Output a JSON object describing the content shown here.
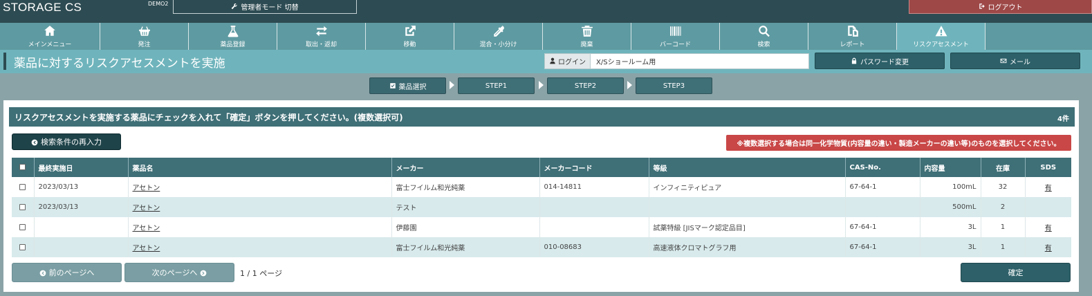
{
  "brand": "STORAGE CS",
  "demo_label": "DEMO2",
  "admin_button": "管理者モード 切替",
  "logout_button": "ログアウト",
  "nav": [
    {
      "label": "メインメニュー",
      "icon": "home-icon"
    },
    {
      "label": "発注",
      "icon": "basket-icon"
    },
    {
      "label": "薬品登録",
      "icon": "flask-icon"
    },
    {
      "label": "取出・返却",
      "icon": "exchange-icon"
    },
    {
      "label": "移動",
      "icon": "external-link-icon"
    },
    {
      "label": "混合・小分け",
      "icon": "dropper-icon"
    },
    {
      "label": "廃棄",
      "icon": "trash-icon"
    },
    {
      "label": "バーコード",
      "icon": "barcode-icon"
    },
    {
      "label": "検索",
      "icon": "search-icon"
    },
    {
      "label": "レポート",
      "icon": "copy-icon"
    },
    {
      "label": "リスクアセスメント",
      "icon": "warning-icon",
      "active": true
    }
  ],
  "page_title": "薬品に対するリスクアセスメントを実施",
  "login": {
    "label": "ログイン",
    "value": "X/Sショールーム用"
  },
  "password_button": "パスワード変更",
  "mail_button": "メール",
  "steps": [
    "薬品選択",
    "STEP1",
    "STEP2",
    "STEP3"
  ],
  "panel": {
    "heading": "リスクアセスメントを実施する薬品にチェックを入れて「確定」ボタンを押してください。(複数選択可)",
    "count": "4件",
    "reenter_button": "検索条件の再入力",
    "warning": "※複数選択する場合は同一化学物質(内容量の違い・製造メーカーの違い等)のものを選択してください。"
  },
  "table": {
    "headers": [
      "最終実施日",
      "薬品名",
      "メーカー",
      "メーカーコード",
      "等級",
      "CAS-No.",
      "内容量",
      "在庫",
      "SDS"
    ],
    "rows": [
      {
        "date": "2023/03/13",
        "name": "アセトン",
        "maker": "富士フイルム和光純薬",
        "code": "014-14811",
        "grade": "インフィニティピュア",
        "cas": "67-64-1",
        "volume": "100mL",
        "stock": "32",
        "sds": "有"
      },
      {
        "date": "2023/03/13",
        "name": "アセトン",
        "maker": "テスト",
        "code": "",
        "grade": "",
        "cas": "",
        "volume": "500mL",
        "stock": "2",
        "sds": ""
      },
      {
        "date": "",
        "name": "アセトン",
        "maker": "伊藤園",
        "code": "",
        "grade": "試薬特級 [JISマーク認定品目]",
        "cas": "67-64-1",
        "volume": "3L",
        "stock": "1",
        "sds": "有"
      },
      {
        "date": "",
        "name": "アセトン",
        "maker": "富士フイルム和光純薬",
        "code": "010-08683",
        "grade": "高速液体クロマトグラフ用",
        "cas": "67-64-1",
        "volume": "3L",
        "stock": "1",
        "sds": "有"
      }
    ]
  },
  "prev_button": "前のページへ",
  "next_button": "次のページへ",
  "pager": "1 / 1 ページ",
  "confirm_button": "確定"
}
